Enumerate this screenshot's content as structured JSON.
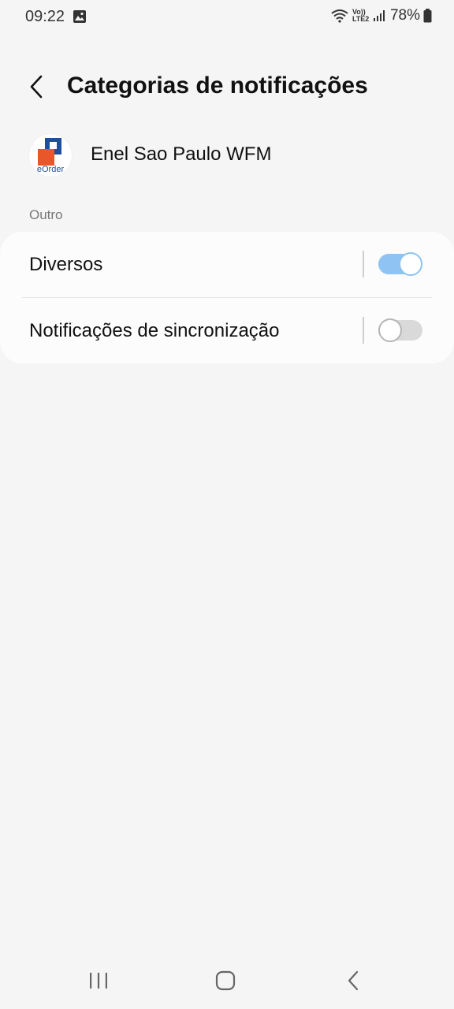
{
  "status_bar": {
    "time": "09:22",
    "network": "Vo)) LTE2",
    "battery_percent": "78%"
  },
  "header": {
    "title": "Categorias de notificações"
  },
  "app": {
    "name": "Enel Sao Paulo WFM",
    "icon_text": "eOrder"
  },
  "section": {
    "label": "Outro",
    "items": [
      {
        "label": "Diversos",
        "enabled": true
      },
      {
        "label": "Notificações de sincronização",
        "enabled": false
      }
    ]
  },
  "colors": {
    "accent": "#8ec3f3",
    "background": "#f5f5f5",
    "card": "#fcfcfc",
    "app_orange": "#e8572a",
    "app_blue": "#1f4e9c"
  }
}
